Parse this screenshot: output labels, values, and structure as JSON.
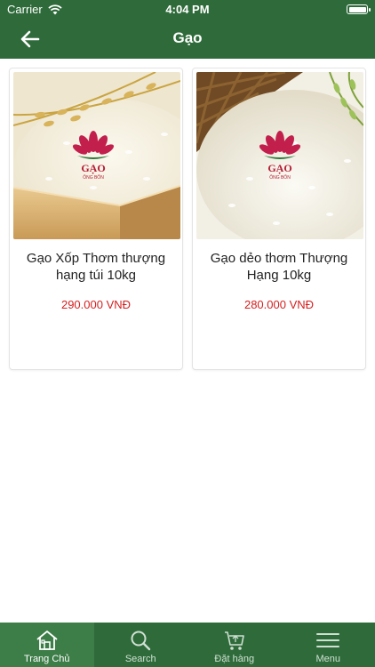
{
  "status_bar": {
    "carrier": "Carrier",
    "time": "4:04 PM"
  },
  "nav": {
    "title": "Gạo",
    "back_icon": "arrow-left-icon"
  },
  "products": [
    {
      "name": "Gạo Xốp Thơm thượng hạng túi 10kg",
      "price": "290.000 VNĐ",
      "brand_logo": "GẠO ÔNG BỐN"
    },
    {
      "name": "Gạo dẻo thơm Thượng Hạng 10kg",
      "price": "280.000 VNĐ",
      "brand_logo": "GẠO ÔNG BỐN"
    }
  ],
  "tabs": [
    {
      "label": "Trang Chủ",
      "icon": "home-icon",
      "active": true
    },
    {
      "label": "Search",
      "icon": "search-icon",
      "active": false
    },
    {
      "label": "Đặt hàng",
      "icon": "cart-icon",
      "active": false
    },
    {
      "label": "Menu",
      "icon": "menu-icon",
      "active": false
    }
  ],
  "colors": {
    "brand_green": "#2f6b3a",
    "price_red": "#d42020"
  }
}
